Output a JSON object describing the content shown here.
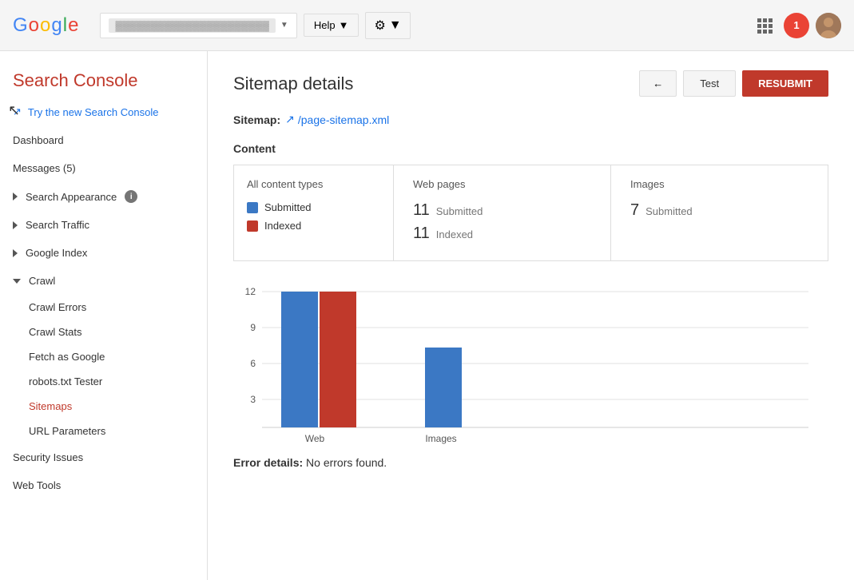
{
  "topbar": {
    "logo": {
      "g": "G",
      "o1": "o",
      "o2": "o",
      "g2": "g",
      "l": "l",
      "e": "e"
    },
    "notification_count": "1",
    "help_label": "Help",
    "settings_label": "⚙"
  },
  "sidebar": {
    "title": "Search Console",
    "try_new_label": "Try the new Search Console",
    "dashboard_label": "Dashboard",
    "messages_label": "Messages (5)",
    "search_appearance_label": "Search Appearance",
    "search_traffic_label": "Search Traffic",
    "google_index_label": "Google Index",
    "crawl_label": "Crawl",
    "crawl_errors_label": "Crawl Errors",
    "crawl_stats_label": "Crawl Stats",
    "fetch_as_google_label": "Fetch as Google",
    "robots_txt_label": "robots.txt Tester",
    "sitemaps_label": "Sitemaps",
    "url_parameters_label": "URL Parameters",
    "security_issues_label": "Security Issues",
    "web_tools_label": "Web Tools"
  },
  "main": {
    "page_title": "Sitemap details",
    "sitemap_label": "Sitemap:",
    "sitemap_url": "/page-sitemap.xml",
    "back_label": "←",
    "test_label": "Test",
    "resubmit_label": "RESUBMIT",
    "content_label": "Content",
    "all_content_types_label": "All content types",
    "legend_submitted_label": "Submitted",
    "legend_indexed_label": "Indexed",
    "web_pages_label": "Web pages",
    "images_label": "Images",
    "web_submitted_count": "11",
    "web_indexed_count": "11",
    "images_submitted_count": "7",
    "images_submitted_label": "Submitted",
    "submitted_label": "Submitted",
    "indexed_label": "Indexed",
    "chart": {
      "y_labels": [
        "12",
        "9",
        "6",
        "3"
      ],
      "bars": [
        {
          "group_label": "Web",
          "submitted_height": 170,
          "indexed_height": 170
        },
        {
          "group_label": "Images",
          "submitted_height": 100,
          "indexed_height": 0
        }
      ]
    },
    "error_details_label": "Error details:",
    "error_details_value": "No errors found."
  }
}
